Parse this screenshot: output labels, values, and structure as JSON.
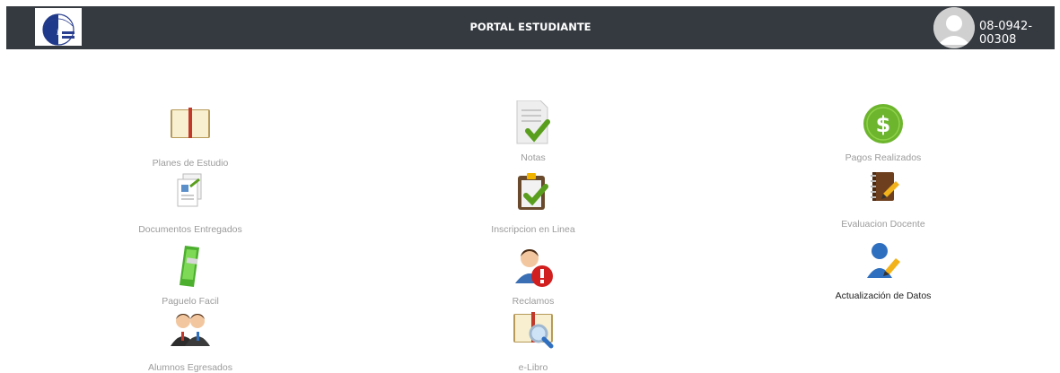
{
  "header": {
    "title": "PORTAL ESTUDIANTE",
    "user_id": "08-0942-00308"
  },
  "menu": {
    "items": [
      {
        "label": "Planes de Estudio",
        "icon": "open-book-icon"
      },
      {
        "label": "Notas",
        "icon": "document-check-icon"
      },
      {
        "label": "Pagos Realizados",
        "icon": "dollar-coin-icon"
      },
      {
        "label": "Documentos Entregados",
        "icon": "documents-icon"
      },
      {
        "label": "Inscripcion en Linea",
        "icon": "clipboard-check-icon"
      },
      {
        "label": "Evaluacion Docente",
        "icon": "notebook-pencil-icon"
      },
      {
        "label": "Paguelo Facil",
        "icon": "mobile-payment-icon"
      },
      {
        "label": "Reclamos",
        "icon": "user-alert-icon"
      },
      {
        "label": "Actualización de Datos",
        "icon": "user-edit-icon"
      },
      {
        "label": "Alumnos Egresados",
        "icon": "graduates-icon"
      },
      {
        "label": "e-Libro",
        "icon": "book-search-icon"
      }
    ]
  },
  "colors": {
    "topbar": "#343a40",
    "label": "#9b9b9b",
    "highlight_label": "#222222",
    "check_green": "#5a9e1e",
    "coin_green": "#6cb52d",
    "alert_red": "#d11f1f"
  }
}
